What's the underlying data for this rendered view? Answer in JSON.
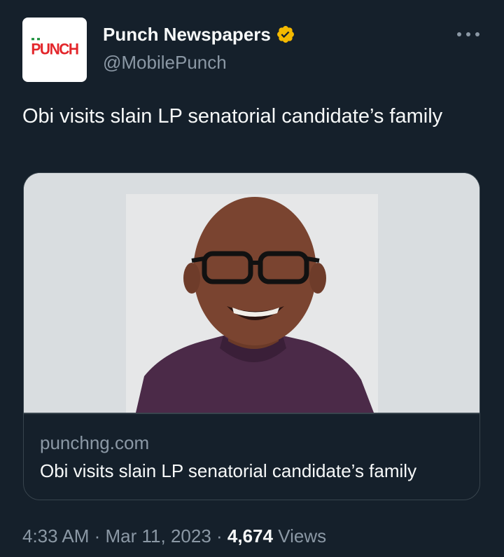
{
  "account": {
    "avatar_logo_text": "PUNCH",
    "display_name": "Punch Newspapers",
    "handle": "@MobilePunch",
    "verified_badge_icon": "verified-badge-icon",
    "verified_color": "#f4b900",
    "brand_color": "#e3262b"
  },
  "menu": {
    "more_icon": "more-horizontal-icon"
  },
  "tweet": {
    "text": "Obi visits slain LP senatorial candidate’s family"
  },
  "card": {
    "image_description_icon": "article-photo",
    "domain": "punchng.com",
    "title": "Obi visits slain LP senatorial candidate’s family"
  },
  "meta": {
    "time": "4:33 AM",
    "separator1": " · ",
    "date": "Mar 11, 2023",
    "separator2": " · ",
    "views_count": "4,674",
    "views_label": " Views"
  },
  "colors": {
    "background": "#15202b",
    "text_primary": "#f7f9f9",
    "text_secondary": "#8b98a5",
    "border": "#38444d"
  }
}
